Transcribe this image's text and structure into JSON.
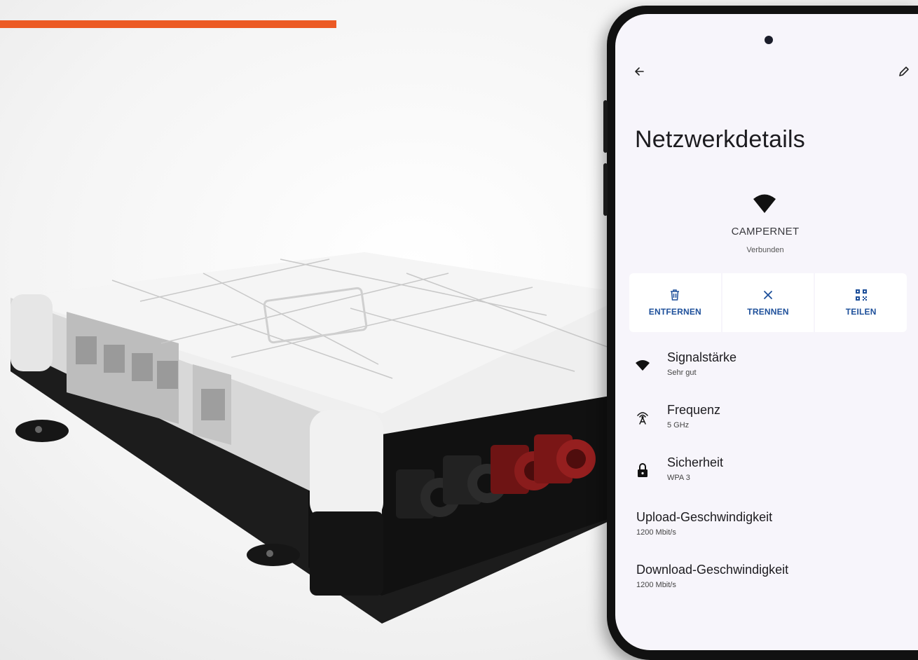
{
  "accent_color": "#ec5a24",
  "screen": {
    "title": "Netzwerkdetails",
    "network_name": "CAMPERNET",
    "network_status": "Verbunden",
    "icons": {
      "back": "arrow-left-icon",
      "edit": "pencil-icon",
      "network": "wifi-icon"
    },
    "actions": [
      {
        "label": "ENTFERNEN",
        "icon": "trash-icon"
      },
      {
        "label": "TRENNEN",
        "icon": "close-icon"
      },
      {
        "label": "TEILEN",
        "icon": "qr-code-icon"
      }
    ],
    "details": [
      {
        "title": "Signalstärke",
        "value": "Sehr gut",
        "icon": "wifi-icon"
      },
      {
        "title": "Frequenz",
        "value": "5 GHz",
        "icon": "antenna-icon"
      },
      {
        "title": "Sicherheit",
        "value": "WPA 3",
        "icon": "lock-icon"
      },
      {
        "title": "Upload-Geschwindigkeit",
        "value": "1200 Mbit/s"
      },
      {
        "title": "Download-Geschwindigkeit",
        "value": "1200 Mbit/s"
      }
    ],
    "action_color": "#1d4f9a"
  }
}
